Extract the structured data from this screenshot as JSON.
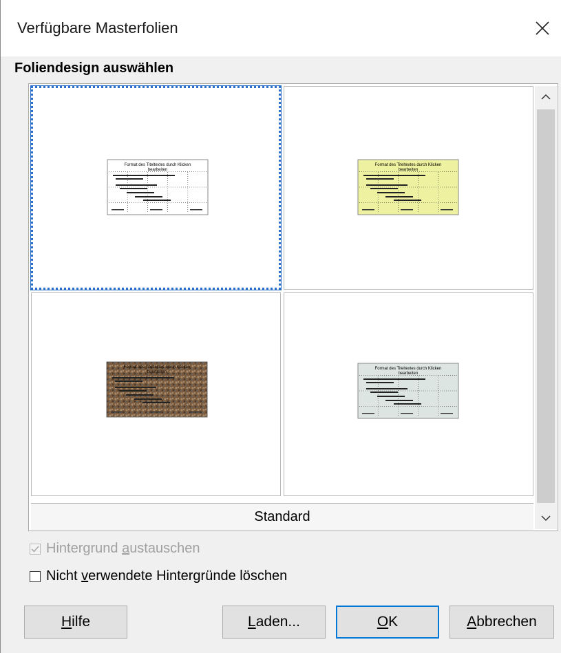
{
  "window": {
    "title": "Verfügbare Masterfolien"
  },
  "section": {
    "label": "Foliendesign auswählen"
  },
  "gallery": {
    "selected_name": "Standard",
    "tiles": [
      {
        "name": "thumb-1",
        "bg": "#ffffff"
      },
      {
        "name": "thumb-2",
        "bg": "#eef2a0"
      },
      {
        "name": "thumb-3",
        "bg": "#8a6a4a"
      },
      {
        "name": "thumb-4",
        "bg": "#dde5e3"
      }
    ],
    "thumb_title": "Format des Titeltextes durch Klicken",
    "thumb_title2": "bearbeiten"
  },
  "options": {
    "replace_bg": {
      "pre": "Hintergrund ",
      "u": "a",
      "post": "ustauschen",
      "checked": true,
      "enabled": false
    },
    "delete_unused": {
      "pre": "Nicht ",
      "u": "v",
      "post": "erwendete Hintergründe löschen",
      "checked": false,
      "enabled": true
    }
  },
  "buttons": {
    "help": {
      "u": "H",
      "rest": "ilfe"
    },
    "load": {
      "u": "L",
      "rest": "aden..."
    },
    "ok": {
      "u": "O",
      "rest": "K"
    },
    "cancel": {
      "u": "A",
      "rest": "bbrechen"
    }
  },
  "colors": {
    "accent": "#0078d7",
    "selection": "#2a6fc9"
  }
}
